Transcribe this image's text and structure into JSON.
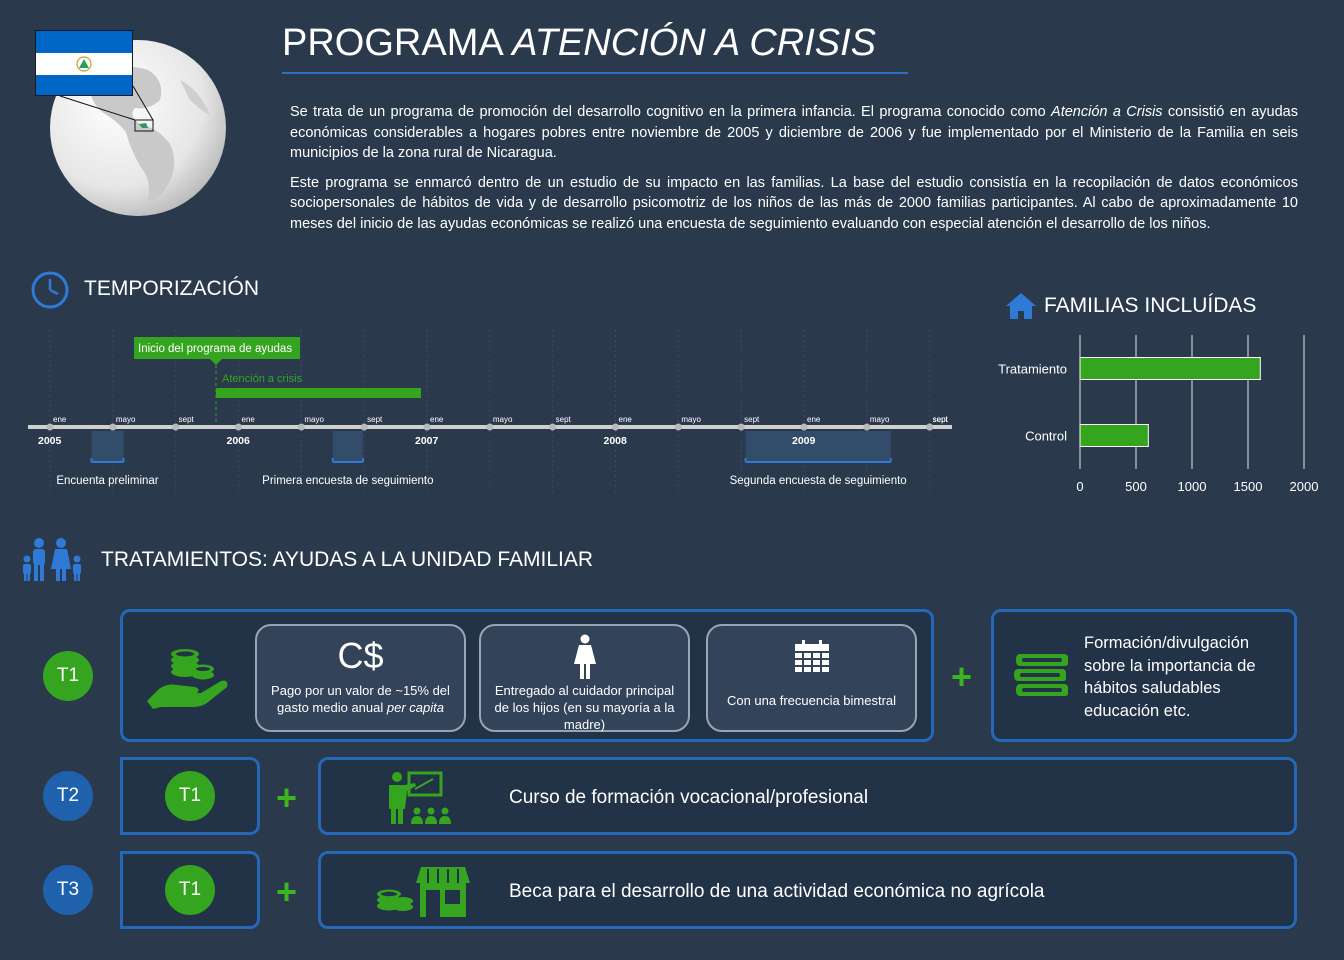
{
  "header": {
    "title_main": "PROGRAMA",
    "title_italic": "ATENCIÓN A CRISIS"
  },
  "intro": {
    "p1_a": "Se trata de un programa de promoción del desarrollo cognitivo en la primera infancia. El programa conocido como ",
    "p1_italic": "Atención a Crisis",
    "p1_b": " consistió en ayudas económicas considerables a hogares pobres entre noviembre de 2005 y diciembre de 2006 y fue implementado por el Ministerio de la Familia en seis municipios  de la zona rural de Nicaragua.",
    "p2": "Este programa se enmarcó dentro de un estudio de su impacto en las familias. La base del estudio consistía en la recopilación de datos económicos sociopersonales de hábitos de vida y de desarrollo psicomotriz de los niños de las más de 2000 familias participantes. Al cabo de aproximadamente 10 meses del inicio de las ayudas económicas se realizó una encuesta de seguimiento evaluando con especial atención el desarrollo de los niños."
  },
  "timeline": {
    "title": "TEMPORIZACIÓN",
    "start_label": "Inicio del programa de ayudas",
    "bar_label": "Atención a crisis",
    "years": [
      "2005",
      "2006",
      "2007",
      "2008",
      "2009"
    ],
    "months": [
      "ene",
      "mayo",
      "sept"
    ],
    "surveys": [
      "Encuenta preliminar",
      "Primera encuesta de seguimiento",
      "Segunda encuesta de seguimiento"
    ]
  },
  "families": {
    "title": "FAMILIAS INCLUÍDAS"
  },
  "chart_data": {
    "type": "bar",
    "orientation": "horizontal",
    "categories": [
      "Tratamiento",
      "Control"
    ],
    "values": [
      1610,
      610
    ],
    "xlim": [
      0,
      2000
    ],
    "xticks": [
      "0",
      "500",
      "1000",
      "1500",
      "2000"
    ],
    "grid": true,
    "color": "#35a51f"
  },
  "treatments": {
    "title": "TRATAMIENTOS: AYUDAS A LA UNIDAD FAMILIAR",
    "t1": {
      "label": "T1",
      "currency": "C$",
      "card1_a": "Pago por un valor de  ~15% del gasto medio anual ",
      "card1_italic": "per capita",
      "card2": "Entregado al cuidador principal de los hijos (en su mayoría a la madre)",
      "card3": "Con una frecuencia  bimestral",
      "plus": "+",
      "extra": "Formación/divulgación sobre la importancia de hábitos saludables educación etc."
    },
    "t2": {
      "label": "T2",
      "inner": "T1",
      "plus": "+",
      "text": "Curso  de formación vocacional/profesional"
    },
    "t3": {
      "label": "T3",
      "inner": "T1",
      "plus": "+",
      "text": "Beca para  el desarrollo  de una actividad  económica  no agrícola"
    }
  },
  "colors": {
    "background": "#2b394d",
    "accent_blue": "#2568b8",
    "accent_green": "#35a51f"
  }
}
